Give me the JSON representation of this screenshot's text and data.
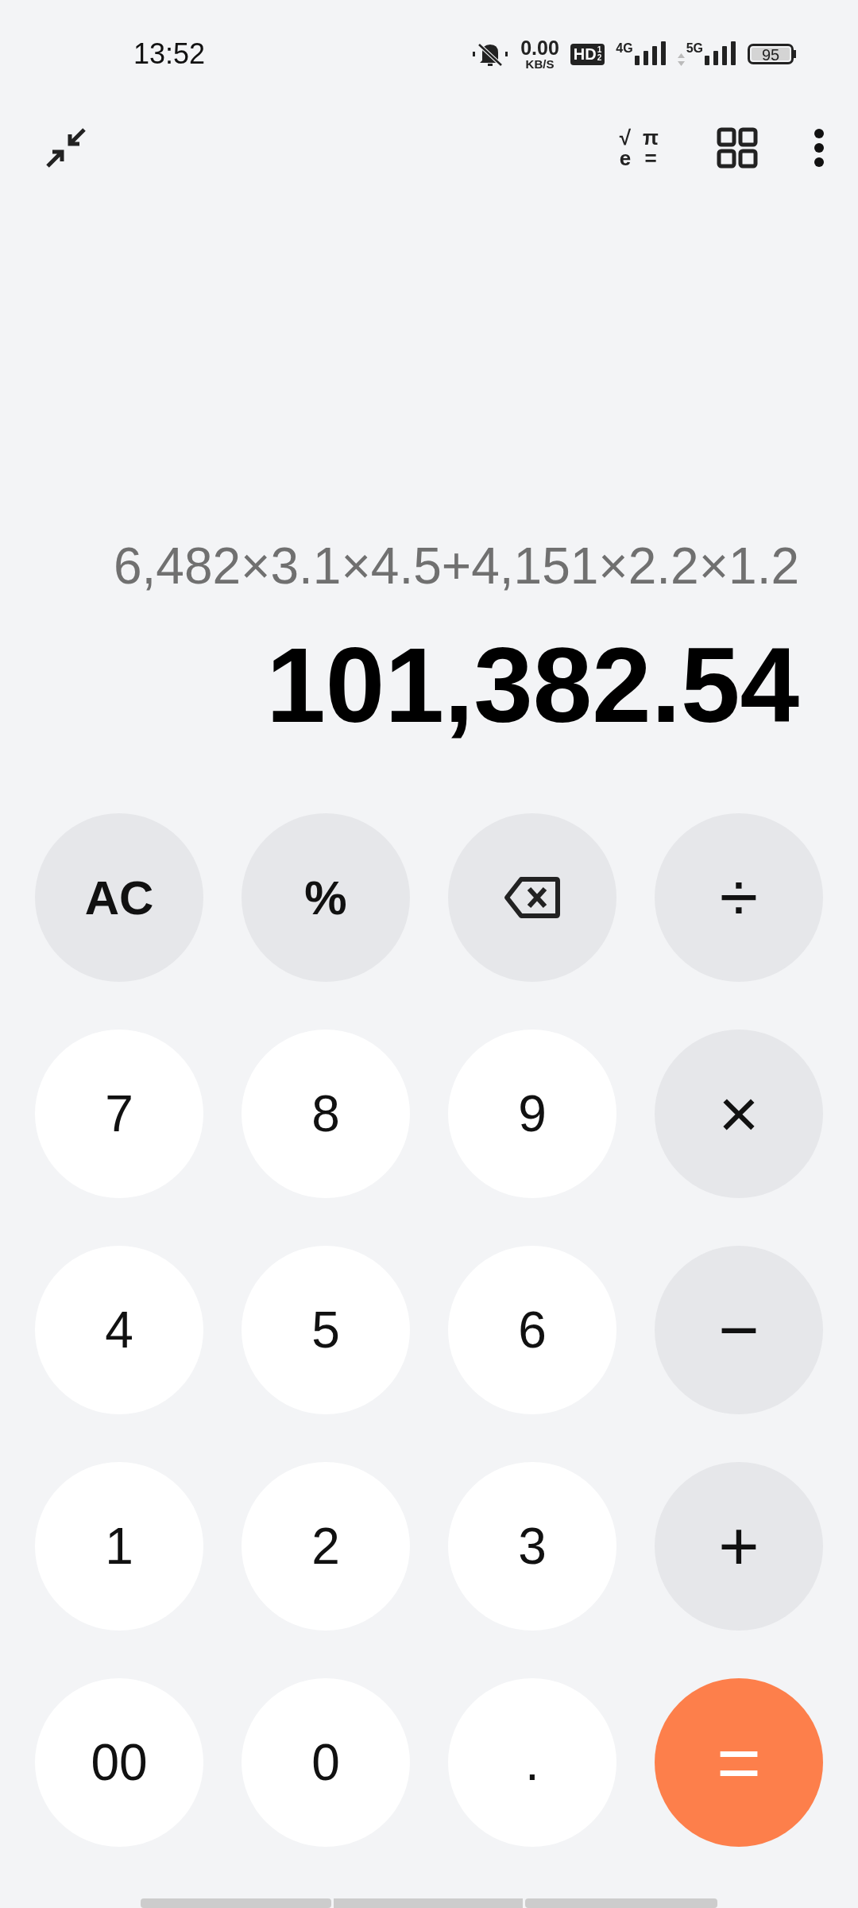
{
  "status_bar": {
    "time": "13:52",
    "speed": "0.00",
    "speed_unit": "KB/S",
    "hd": "HD",
    "hd_sub": "1",
    "hd_sub2": "2",
    "net1": "4G",
    "net2": "5G",
    "battery": "95"
  },
  "toolbar": {
    "sci_symbols": [
      "√",
      "π",
      "e",
      "="
    ]
  },
  "display": {
    "expression": "6,482×3.1×4.5+4,151×2.2×1.2",
    "result": "101,382.54"
  },
  "keys": [
    {
      "label": "AC",
      "kind": "function"
    },
    {
      "label": "%",
      "kind": "function"
    },
    {
      "kind": "backspace"
    },
    {
      "label": "÷",
      "kind": "operator"
    },
    {
      "label": "7",
      "kind": "digit"
    },
    {
      "label": "8",
      "kind": "digit"
    },
    {
      "label": "9",
      "kind": "digit"
    },
    {
      "label": "×",
      "kind": "operator"
    },
    {
      "label": "4",
      "kind": "digit"
    },
    {
      "label": "5",
      "kind": "digit"
    },
    {
      "label": "6",
      "kind": "digit"
    },
    {
      "label": "−",
      "kind": "operator"
    },
    {
      "label": "1",
      "kind": "digit"
    },
    {
      "label": "2",
      "kind": "digit"
    },
    {
      "label": "3",
      "kind": "digit"
    },
    {
      "label": "+",
      "kind": "operator"
    },
    {
      "label": "00",
      "kind": "digit"
    },
    {
      "label": "0",
      "kind": "digit"
    },
    {
      "label": ".",
      "kind": "digit"
    },
    {
      "label": "=",
      "kind": "equals"
    }
  ]
}
